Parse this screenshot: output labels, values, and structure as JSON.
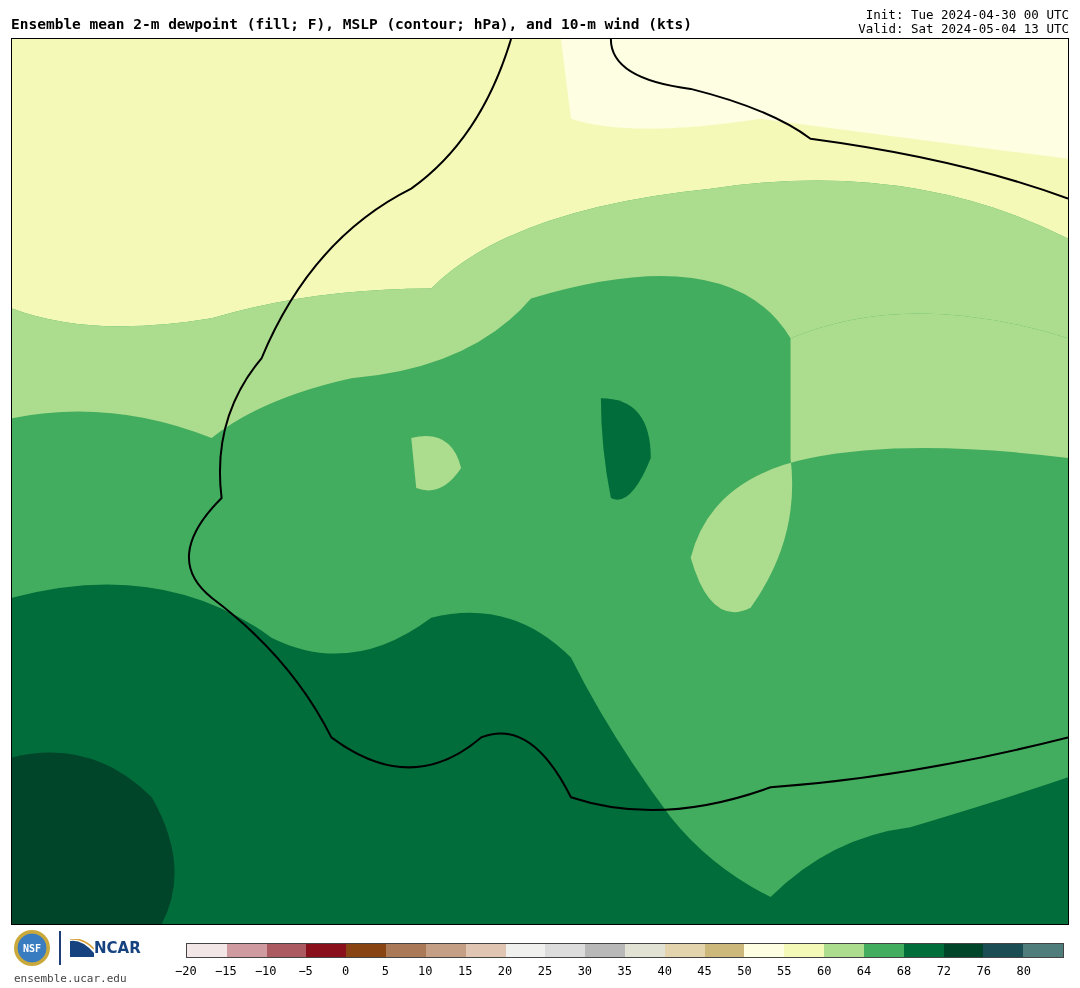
{
  "title": "Ensemble mean 2-m dewpoint (fill; F), MSLP (contour; hPa), and 10-m wind (kts)",
  "init": "Init: Tue 2024-04-30 00 UTC",
  "valid": "Valid: Sat 2024-05-04 13 UTC",
  "logos": {
    "nsf": "NSF",
    "ncar": "NCAR",
    "url": "ensemble.ucar.edu"
  },
  "colorbar": {
    "bins": [
      {
        "color": "#f3e6e6"
      },
      {
        "color": "#d09ba0"
      },
      {
        "color": "#ab5a61"
      },
      {
        "color": "#8a111c"
      },
      {
        "color": "#884412"
      },
      {
        "color": "#aa7a58"
      },
      {
        "color": "#c49e85"
      },
      {
        "color": "#e0c5b3"
      },
      {
        "color": "#f0f0ee"
      },
      {
        "color": "#dcdcdc"
      },
      {
        "color": "#b8b8b8"
      },
      {
        "color": "#e2e2d4"
      },
      {
        "color": "#e4d4ae"
      },
      {
        "color": "#ccb87a"
      },
      {
        "color": "#fefee2"
      },
      {
        "color": "#f5f9b8"
      },
      {
        "color": "#acdc8e"
      },
      {
        "color": "#42ad5e"
      },
      {
        "color": "#006d3a"
      },
      {
        "color": "#00442a"
      },
      {
        "color": "#1b4d55"
      },
      {
        "color": "#4f7d7c"
      }
    ],
    "labels": [
      "−20",
      "−15",
      "−10",
      "−5",
      "0",
      "5",
      "10",
      "15",
      "20",
      "25",
      "30",
      "35",
      "40",
      "45",
      "50",
      "55",
      "60",
      "64",
      "68",
      "72",
      "76",
      "80"
    ]
  }
}
